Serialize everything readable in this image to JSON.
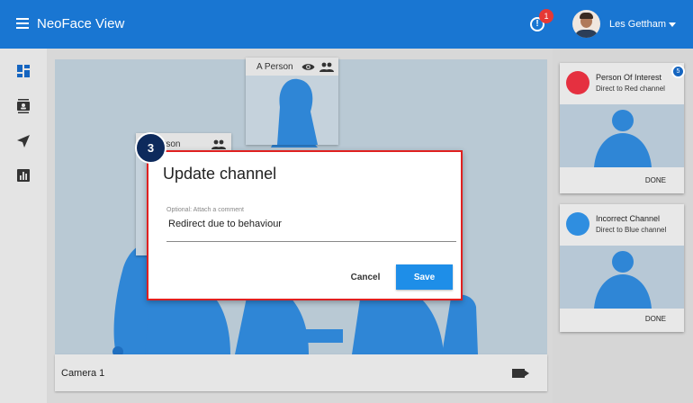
{
  "app": {
    "title": "NeoFace View",
    "alert_count": "1",
    "alert_glyph": "!",
    "user_name": "Les Gettham"
  },
  "sidebar": {
    "items": [
      {
        "icon": "dashboard-icon"
      },
      {
        "icon": "contacts-icon"
      },
      {
        "icon": "navigation-icon"
      },
      {
        "icon": "bar-chart-icon"
      }
    ]
  },
  "camera": {
    "footer_label": "Camera 1",
    "detections": [
      {
        "name": "A Person"
      },
      {
        "name": "rson"
      }
    ]
  },
  "step": {
    "number": "3"
  },
  "dialog": {
    "title": "Update channel",
    "comment_hint": "Optional: Attach a comment",
    "comment_value": "Redirect due to behaviour",
    "cancel_label": "Cancel",
    "save_label": "Save"
  },
  "alerts": [
    {
      "title": "Person Of Interest",
      "subtitle": "Direct to Red channel",
      "color": "#e53040",
      "done_label": "DONE",
      "count": "5"
    },
    {
      "title": "Incorrect Channel",
      "subtitle": "Direct to Blue channel",
      "color": "#2f8ee0",
      "done_label": "DONE"
    }
  ],
  "colors": {
    "appbar": "#1976d2",
    "accent": "#1e8ee8",
    "highlight": "#e02020",
    "silhouette": "#2f86d6"
  }
}
